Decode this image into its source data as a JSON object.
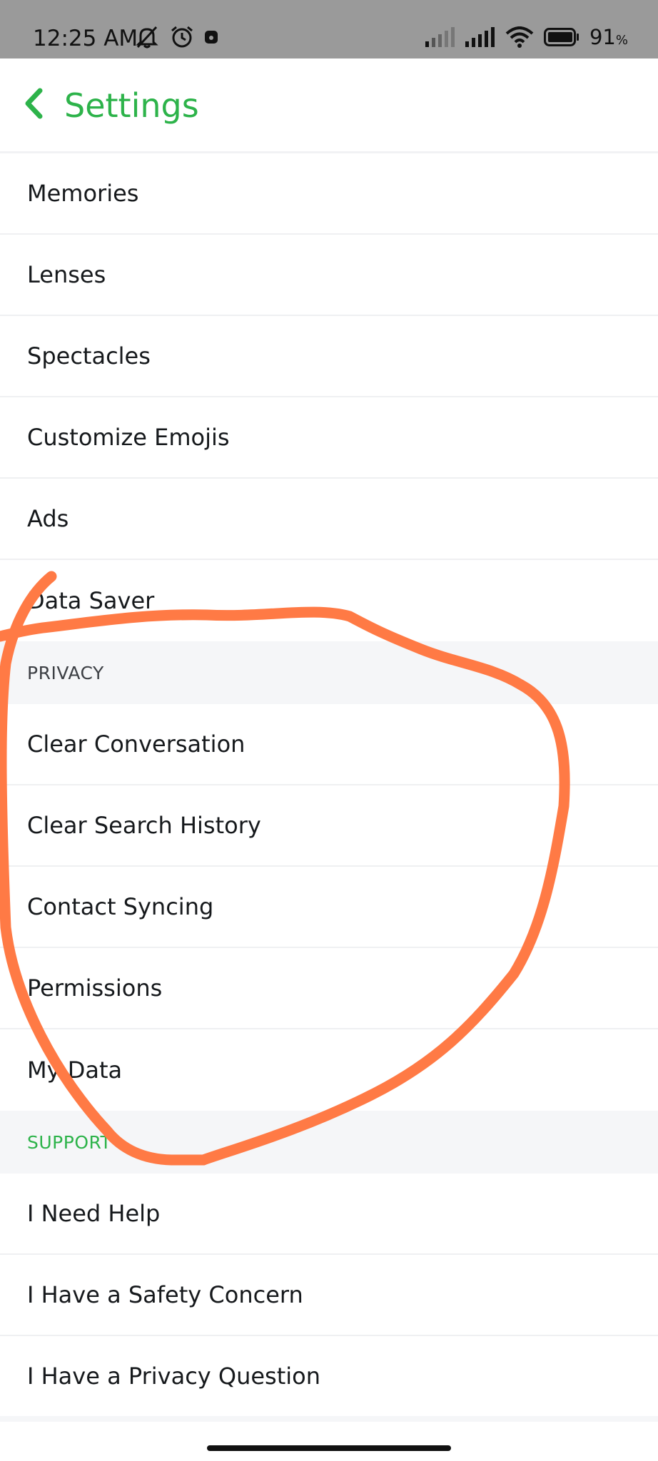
{
  "status_bar": {
    "time": "12:25 AM",
    "battery_percent": "91",
    "battery_unit": "%",
    "icons": [
      "mute-icon",
      "alarm-icon",
      "notification-icon",
      "signal-icon",
      "signal-icon",
      "wifi-icon",
      "battery-icon"
    ]
  },
  "header": {
    "title": "Settings",
    "back_icon": "chevron-left-icon",
    "accent_color": "#2db34a"
  },
  "list": {
    "general_items": [
      "Memories",
      "Lenses",
      "Spectacles",
      "Customize Emojis",
      "Ads",
      "Data Saver"
    ],
    "privacy_header": "PRIVACY",
    "privacy_items": [
      "Clear Conversation",
      "Clear Search History",
      "Contact Syncing",
      "Permissions",
      "My Data"
    ],
    "support_header": "SUPPORT",
    "support_items": [
      "I Need Help",
      "I Have a Safety Concern",
      "I Have a Privacy Question"
    ]
  },
  "annotation": {
    "color": "#ff7a45"
  }
}
